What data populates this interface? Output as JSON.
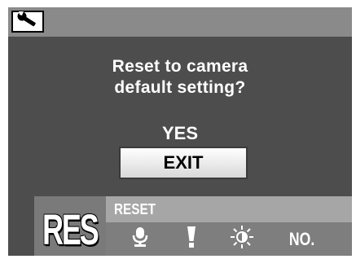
{
  "header": {
    "setup_icon": "wrench-icon"
  },
  "dialog": {
    "message_line1": "Reset to camera",
    "message_line2": "default setting?",
    "options": [
      {
        "label": "YES",
        "selected": false
      },
      {
        "label": "EXIT",
        "selected": true
      }
    ]
  },
  "menu": {
    "current_icon_text": "RES",
    "current_label": "RESET",
    "tabs": [
      {
        "icon": "microphone-icon"
      },
      {
        "icon": "exclamation-icon"
      },
      {
        "icon": "brightness-icon"
      },
      {
        "icon": "file-numbering-icon",
        "label": "NO."
      }
    ]
  },
  "colors": {
    "screen_bg": "#4d4d4d",
    "header_bg": "#8a8a8a",
    "label_bar_bg": "#a6a6a6",
    "icon_row_bg": "#7e7e7e",
    "text": "#ffffff"
  }
}
